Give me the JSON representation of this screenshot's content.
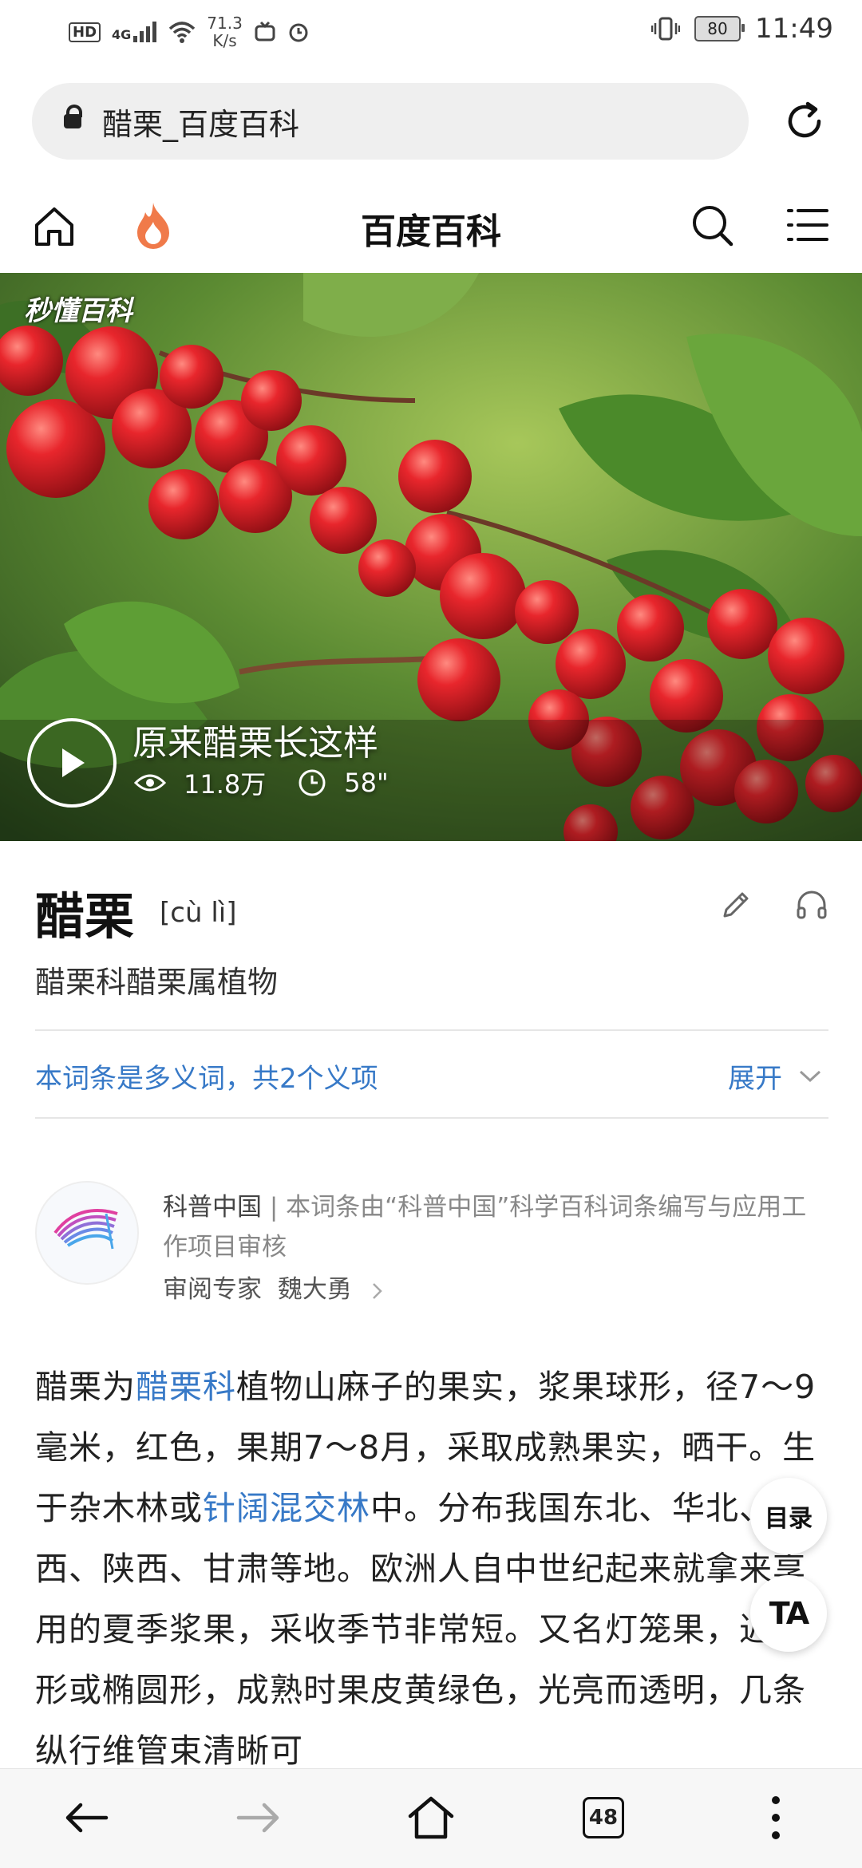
{
  "status_bar": {
    "hd": "HD",
    "network": "4G",
    "speed_value": "71.3",
    "speed_unit": "K/s",
    "battery": "80",
    "time": "11:49"
  },
  "browser": {
    "address": "醋栗_百度百科",
    "open_tabs": "48"
  },
  "site": {
    "title": "百度百科"
  },
  "video": {
    "brand": "秒懂百科",
    "title": "原来醋栗长这样",
    "views": "11.8万",
    "duration": "58\""
  },
  "entry": {
    "title": "醋栗",
    "pinyin": "[cù lì]",
    "description": "醋栗科醋栗属植物",
    "polysemy": "本词条是多义词，共2个义项",
    "expand_label": "展开"
  },
  "review": {
    "org_name": "科普中国",
    "separator": " | ",
    "org_text": "本词条由“科普中国”科学百科词条编写与应用工作项目审核",
    "expert_label": "审阅专家",
    "expert_name": "魏大勇"
  },
  "body": {
    "p1": "醋栗为",
    "link1": "醋栗科",
    "p2": "植物山麻子的果实，浆果球形，径7～9毫米，红色，果期7～8月，采取成熟果实，晒干。生于杂木林或",
    "link2": "针阔混交林",
    "p3": "中。分布我国东北、华北、山西、陕西、甘肃等地。欧洲人自中世纪起来就拿来享用的夏季浆果，采收季节非常短。又名灯笼果，近圆形或椭圆形，成熟时果皮黄绿色，光亮而透明，几条纵行维管束清晰可"
  },
  "floating": {
    "toc": "目录",
    "ta": "TA"
  },
  "colors": {
    "link": "#3779c7",
    "hot_icon": "#f07a4a",
    "berry": "#d8232a",
    "leaf": "#4f8a2e"
  }
}
